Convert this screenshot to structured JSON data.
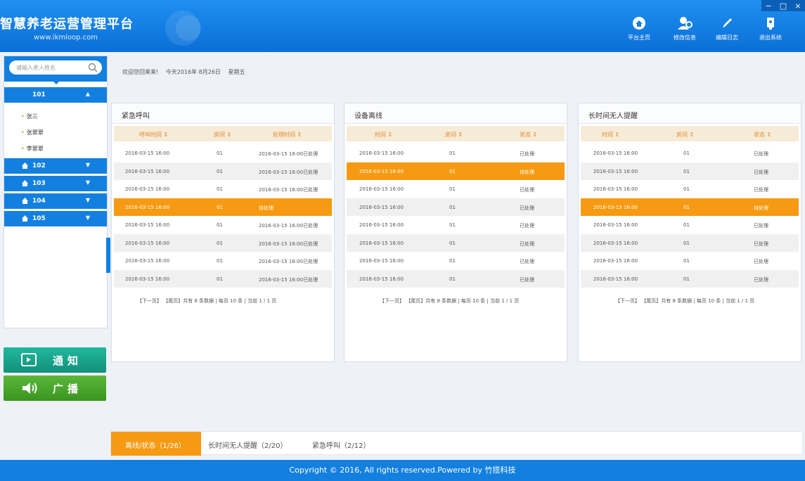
{
  "header": {
    "title": "智慧养老运营管理平台",
    "url": "www.ikmloop.com",
    "window_controls": [
      "−",
      "□",
      "×"
    ],
    "nav": [
      {
        "label": "平台主页",
        "icon": "home-icon"
      },
      {
        "label": "修改信息",
        "icon": "user-edit-icon"
      },
      {
        "label": "编辑日志",
        "icon": "pen-icon"
      },
      {
        "label": "退出系统",
        "icon": "logout-icon"
      }
    ]
  },
  "sidebar": {
    "search_placeholder": "请输入老人姓名",
    "rooms": [
      {
        "num": "101",
        "expanded": true,
        "items": [
          "张三",
          "张翠翠",
          "李翠翠"
        ]
      },
      {
        "num": "102",
        "expanded": false
      },
      {
        "num": "103",
        "expanded": false
      },
      {
        "num": "104",
        "expanded": false
      },
      {
        "num": "105",
        "expanded": false
      }
    ],
    "notify_label": "通知",
    "broadcast_label": "广播",
    "colors": {
      "blue": "#1380e0",
      "teal": "#16a38c",
      "green": "#4aa62a"
    }
  },
  "breadcrumb": [
    "欢迎您回来来!",
    "今天2016年 8月26日",
    "星期五"
  ],
  "panels": [
    {
      "title": "紧急呼叫",
      "headers": [
        "呼叫时间 ↕",
        "房间 ↕",
        "处理时间 ↕"
      ],
      "rows": [
        {
          "c1": "2016-03-15 16:00",
          "c2": "01",
          "c3": "2016-03-15 16:00已处理",
          "state": "normal"
        },
        {
          "c1": "2016-03-15 16:00",
          "c2": "01",
          "c3": "2016-03-15 16:00已处理",
          "state": "alt"
        },
        {
          "c1": "2016-03-15 16:00",
          "c2": "01",
          "c3": "2016-03-15 16:00已处理",
          "state": "normal"
        },
        {
          "c1": "2016-03-15 16:00",
          "c2": "01",
          "c3": "待处理",
          "state": "hl"
        },
        {
          "c1": "2016-03-15 16:00",
          "c2": "01",
          "c3": "2016-03-15 16:00已处理",
          "state": "normal"
        },
        {
          "c1": "2016-03-15 16:00",
          "c2": "01",
          "c3": "2016-03-15 16:00已处理",
          "state": "alt"
        },
        {
          "c1": "2016-03-15 16:00",
          "c2": "01",
          "c3": "2016-03-15 16:00已处理",
          "state": "normal"
        },
        {
          "c1": "2016-03-15 16:00",
          "c2": "01",
          "c3": "2016-03-15 16:00已处理",
          "state": "alt"
        }
      ],
      "pager": "【下一页】 【尾页】共有 8 条数据 | 每页 10 条 | 当前 1 / 1 页"
    },
    {
      "title": "设备离线",
      "headers": [
        "时间 ↕",
        "房间 ↕",
        "状态 ↕"
      ],
      "rows": [
        {
          "c1": "2016-03-15 16:00",
          "c2": "01",
          "c3": "已处理",
          "state": "normal"
        },
        {
          "c1": "2016-03-15 16:00",
          "c2": "01",
          "c3": "待处理",
          "state": "hl"
        },
        {
          "c1": "2016-03-15 16:00",
          "c2": "01",
          "c3": "已处理",
          "state": "normal"
        },
        {
          "c1": "2016-03-15 16:00",
          "c2": "01",
          "c3": "已处理",
          "state": "alt"
        },
        {
          "c1": "2016-03-15 16:00",
          "c2": "01",
          "c3": "已处理",
          "state": "normal"
        },
        {
          "c1": "2016-03-15 16:00",
          "c2": "01",
          "c3": "已处理",
          "state": "alt"
        },
        {
          "c1": "2016-03-15 16:00",
          "c2": "01",
          "c3": "已处理",
          "state": "normal"
        },
        {
          "c1": "2016-03-15 16:00",
          "c2": "01",
          "c3": "已处理",
          "state": "alt"
        }
      ],
      "pager": "【下一页】 【尾页】共有 8 条数据 | 每页 10 条 | 当前 1 / 1 页"
    },
    {
      "title": "长时间无人提醒",
      "headers": [
        "时间 ↕",
        "房间 ↕",
        "状态 ↕"
      ],
      "rows": [
        {
          "c1": "2016-03-15 16:00",
          "c2": "01",
          "c3": "已处理",
          "state": "normal"
        },
        {
          "c1": "2016-03-15 16:00",
          "c2": "01",
          "c3": "已处理",
          "state": "alt"
        },
        {
          "c1": "2016-03-15 16:00",
          "c2": "01",
          "c3": "已处理",
          "state": "normal"
        },
        {
          "c1": "2016-03-15 16:00",
          "c2": "01",
          "c3": "待处理",
          "state": "hl"
        },
        {
          "c1": "2016-03-15 16:00",
          "c2": "01",
          "c3": "已处理",
          "state": "normal"
        },
        {
          "c1": "2016-03-15 16:00",
          "c2": "01",
          "c3": "已处理",
          "state": "alt"
        },
        {
          "c1": "2016-03-15 16:00",
          "c2": "01",
          "c3": "已处理",
          "state": "normal"
        },
        {
          "c1": "2016-03-15 16:00",
          "c2": "01",
          "c3": "已处理",
          "state": "alt"
        }
      ],
      "pager": "【下一页】 【尾页】共有 8 条数据 | 每页 10 条 | 当前 1 / 1 页"
    }
  ],
  "tabs": [
    "离线/状态（1/26）",
    "长时间无人提醒（2/20）",
    "紧急呼叫（2/12）"
  ],
  "footer": "Copyright © 2016, All rights reserved.Powered by 竹揽科技",
  "accent_color": "#f59a12"
}
